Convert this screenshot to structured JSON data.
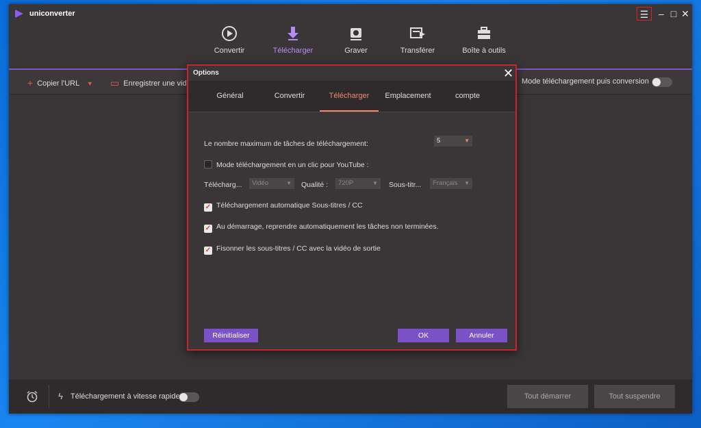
{
  "app": {
    "name": "uniconverter"
  },
  "nav": [
    {
      "label": "Convertir",
      "icon": "convert-icon"
    },
    {
      "label": "Télécharger",
      "icon": "download-icon"
    },
    {
      "label": "Graver",
      "icon": "burn-icon"
    },
    {
      "label": "Transférer",
      "icon": "transfer-icon"
    },
    {
      "label": "Boîte à outils",
      "icon": "toolbox-icon"
    }
  ],
  "toolbar": {
    "copy_url": "Copier l'URL",
    "record": "Enregistrer une vid",
    "mode_label": "Mode téléchargement puis conversion"
  },
  "footer": {
    "speed_label": "Téléchargement à vitesse rapide",
    "start_all": "Tout démarrer",
    "pause_all": "Tout suspendre"
  },
  "dialog": {
    "title": "Options",
    "tabs": [
      "Général",
      "Convertir",
      "Télécharger",
      "Emplacement",
      "compte"
    ],
    "active_tab": "Télécharger",
    "max_tasks_label": "Le nombre maximum de tâches de téléchargement:",
    "max_tasks_value": "5",
    "one_click_label": "Mode téléchargement en un clic pour YouTube :",
    "one_click_checked": false,
    "dl_label": "Télécharg...",
    "dl_value": "Vidéo",
    "quality_label": "Qualité :",
    "quality_value": "720P",
    "subs_label": "Sous-titr...",
    "subs_value": "Français",
    "auto_subs_label": "Téléchargement automatique Sous-titres / CC",
    "resume_label": "Au démarrage, reprendre automatiquement les tâches non terminées.",
    "merge_subs_label": "Fisonner les sous-titres / CC avec la vidéo de sortie",
    "reset_btn": "Réinitialiser",
    "ok_btn": "OK",
    "cancel_btn": "Annuler"
  },
  "colors": {
    "accent": "#7a52c6",
    "highlight": "#f28a6e",
    "frame": "#d0202a"
  }
}
